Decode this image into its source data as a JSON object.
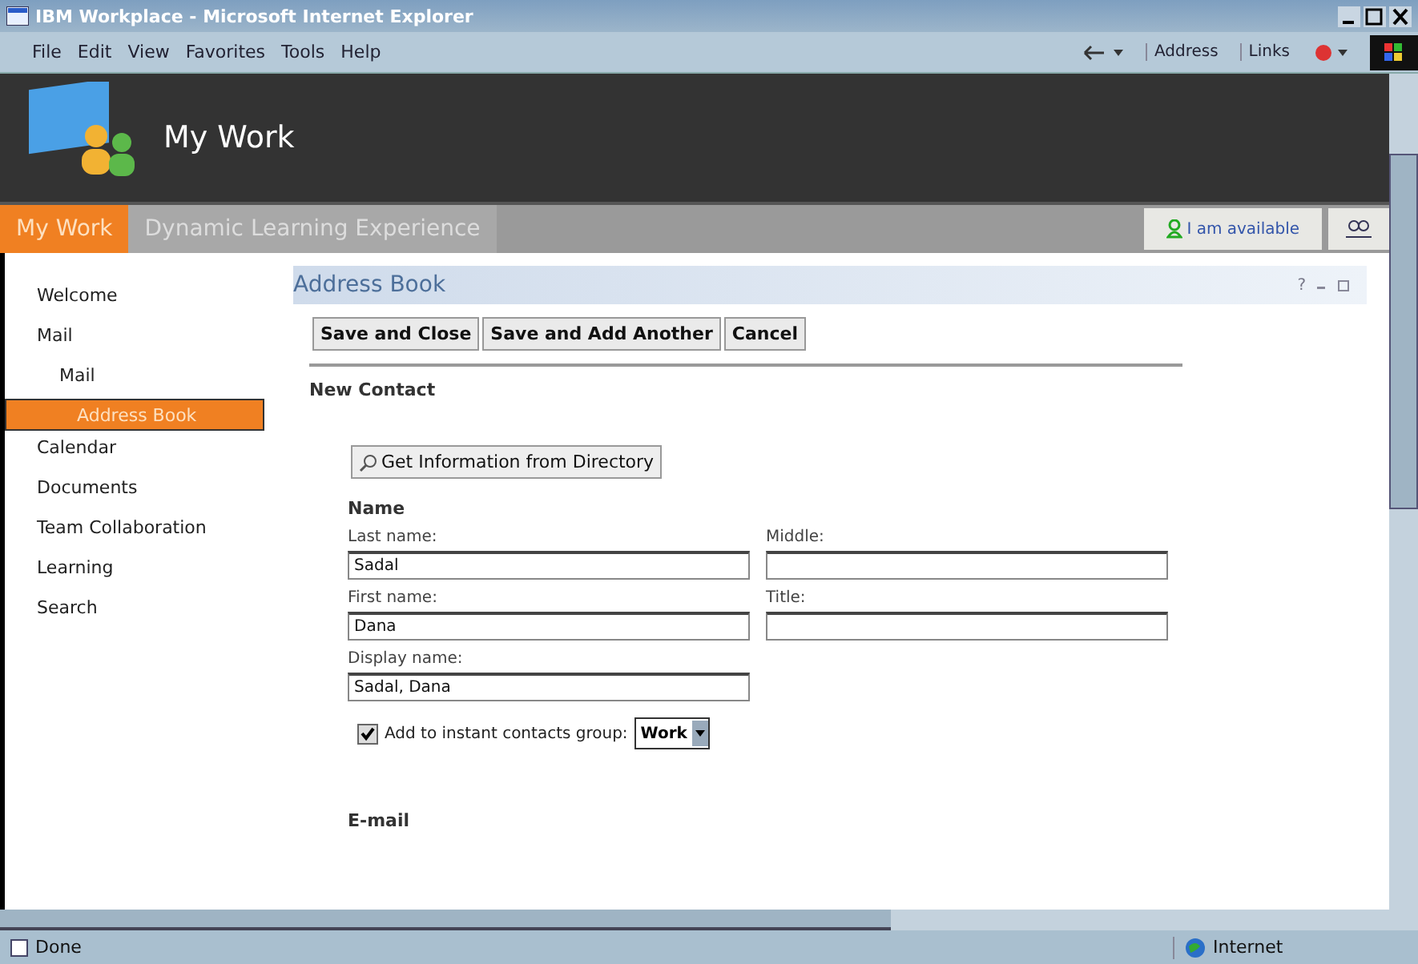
{
  "window": {
    "title": "IBM Workplace - Microsoft Internet Explorer"
  },
  "menu": [
    "File",
    "Edit",
    "View",
    "Favorites",
    "Tools",
    "Help"
  ],
  "toolbar": {
    "address_label": "Address",
    "links_label": "Links"
  },
  "banner": {
    "title": "My Work"
  },
  "tabs": [
    {
      "label": "My Work",
      "selected": true
    },
    {
      "label": "Dynamic Learning Experience",
      "selected": false
    }
  ],
  "availability": "I am available",
  "nav": [
    {
      "label": "Welcome",
      "selected": false
    },
    {
      "label": "Mail",
      "selected": false,
      "children": [
        {
          "label": "Mail",
          "selected": false
        },
        {
          "label": "Address Book",
          "selected": true
        }
      ]
    },
    {
      "label": "Calendar",
      "selected": false
    },
    {
      "label": "Documents",
      "selected": false
    },
    {
      "label": "Team Collaboration",
      "selected": false
    },
    {
      "label": "Learning",
      "selected": false
    },
    {
      "label": "Search",
      "selected": false
    }
  ],
  "portlet": {
    "title": "Address Book",
    "help": "?"
  },
  "actions": [
    "Save and Close",
    "Save and Add Another",
    "Cancel"
  ],
  "form": {
    "heading": "New Contact",
    "directory_button": "Get Information from Directory",
    "section": "Name",
    "rows": [
      [
        {
          "label": "Last name:",
          "value": "Sadal"
        },
        {
          "label": "Middle:"
        }
      ],
      [
        {
          "label": "First name:",
          "value": "Dana"
        },
        {
          "label": "Title:"
        }
      ],
      [
        {
          "label": "Display name:",
          "value": "Sadal, Dana"
        }
      ]
    ],
    "checkbox": {
      "label": "Add to instant contacts group:",
      "checked": true
    },
    "group_select": "Work",
    "next_section": "E-mail"
  },
  "status_bar": {
    "text": "Done",
    "zone": "Internet"
  }
}
